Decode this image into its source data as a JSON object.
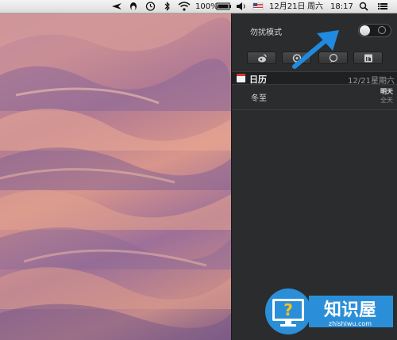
{
  "menubar": {
    "battery": "100%",
    "date": "12月21日",
    "weekday": "周六",
    "time": "18:17",
    "icons": [
      "airplane-icon",
      "qq-penguin-icon",
      "time-machine-icon",
      "bluetooth-icon",
      "wifi-icon",
      "battery-icon",
      "volume-icon",
      "flag-icon",
      "search-icon",
      "list-icon"
    ]
  },
  "notification_center": {
    "do_not_disturb_label": "勿扰模式",
    "toggle_state": "off",
    "share_buttons": [
      "weibo-icon",
      "tencent-weibo-icon",
      "message-icon",
      "linkedin-icon"
    ],
    "calendar": {
      "title": "日历",
      "date": "12/21星期六",
      "events": [
        {
          "title": "冬至",
          "when": "明天",
          "time": "全天"
        }
      ]
    }
  },
  "watermark": {
    "brand": "知识屋",
    "url": "zhishiwu.com"
  },
  "colors": {
    "arrow": "#1f8ae0",
    "panel": "#2b2c2d",
    "watermark": "#2a8fd8"
  }
}
